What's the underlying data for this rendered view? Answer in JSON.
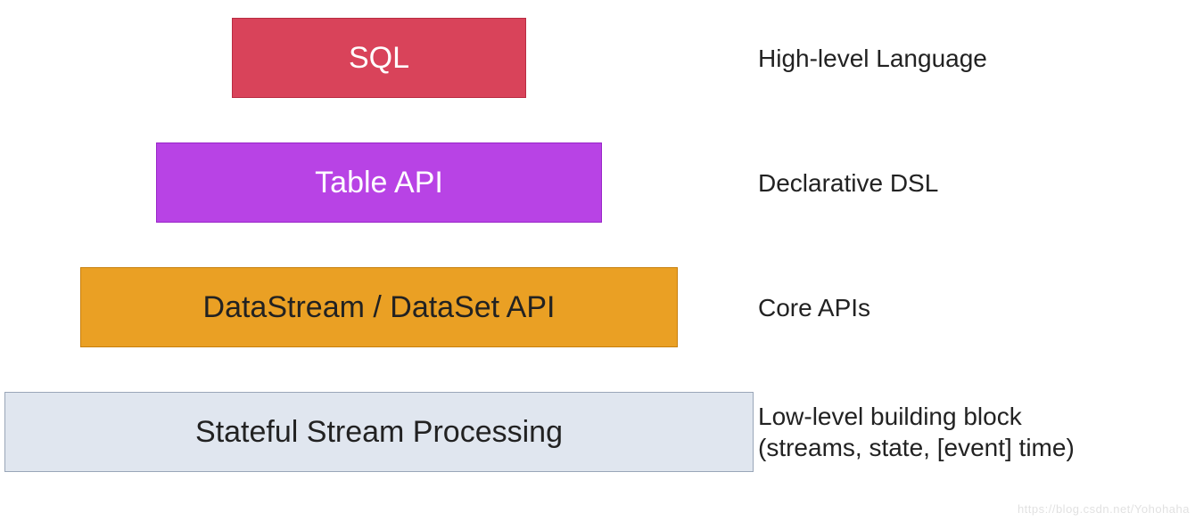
{
  "layers": [
    {
      "box": "SQL",
      "label": "High-level Language"
    },
    {
      "box": "Table API",
      "label": "Declarative DSL"
    },
    {
      "box": "DataStream / DataSet API",
      "label": "Core APIs"
    },
    {
      "box": "Stateful Stream Processing",
      "label": "Low-level building block\n(streams, state, [event] time)"
    }
  ],
  "watermark": "https://blog.csdn.net/Yohohaha"
}
